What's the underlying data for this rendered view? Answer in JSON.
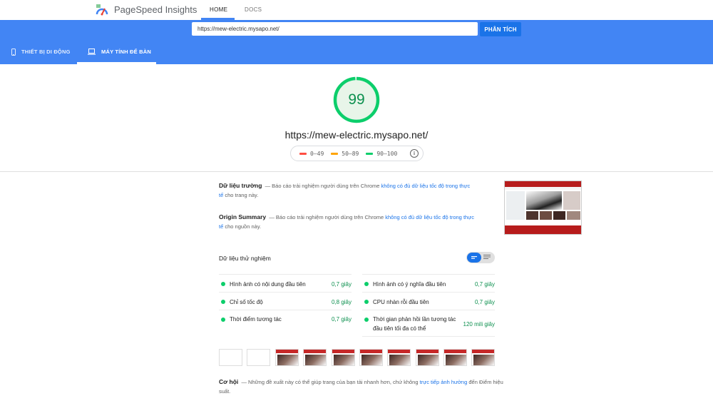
{
  "header": {
    "brand": "PageSpeed Insights",
    "nav": [
      {
        "label": "HOME"
      },
      {
        "label": "DOCS"
      }
    ]
  },
  "search": {
    "url_value": "https://mew-electric.mysapo.net/",
    "button_label": "PHÂN TÍCH"
  },
  "device_tabs": [
    {
      "label": "THIẾT BỊ DI ĐỘNG"
    },
    {
      "label": "MÁY TÍNH ĐỂ BÀN"
    }
  ],
  "score": {
    "value": "99",
    "fraction": 0.99,
    "color": "#0cce6b",
    "url": "https://mew-electric.mysapo.net/"
  },
  "legend": [
    {
      "label": "0–49",
      "color": "#ff4e42"
    },
    {
      "label": "50–89",
      "color": "#ffa400"
    },
    {
      "label": "90–100",
      "color": "#0cce6b"
    }
  ],
  "field_data": {
    "title": "Dữ liệu trường",
    "text": "— Báo cáo trải nghiệm người dùng trên Chrome",
    "link": "không có đủ dữ liệu tốc độ trong thực tế",
    "suffix": "cho trang này."
  },
  "origin_summary": {
    "title": "Origin Summary",
    "text": "— Báo cáo trải nghiệm người dùng trên Chrome",
    "link": "không có đủ dữ liệu tốc độ trong thực tế",
    "suffix": "cho nguồn này."
  },
  "lab": {
    "title": "Dữ liệu thử nghiệm",
    "metrics": [
      {
        "label": "Hình ảnh có nội dung đầu tiên",
        "value": "0,7 giây"
      },
      {
        "label": "Hình ảnh có ý nghĩa đầu tiên",
        "value": "0,7 giây"
      },
      {
        "label": "Chỉ số tốc độ",
        "value": "0,8 giây"
      },
      {
        "label": "CPU nhàn rỗi đầu tiên",
        "value": "0,7 giây"
      },
      {
        "label": "Thời điểm tương tác",
        "value": "0,7 giây"
      },
      {
        "label": "Thời gian phản hồi lần tương tác đầu tiên tối đa có thể",
        "value": "120 mili giây"
      }
    ]
  },
  "opportunities": {
    "title": "Cơ hội",
    "text": "— Những đề xuất này có thể giúp trang của bạn tải nhanh hơn, chứ không",
    "link": "trực tiếp ảnh hưởng",
    "suffix": "đến Điểm hiệu suất."
  }
}
